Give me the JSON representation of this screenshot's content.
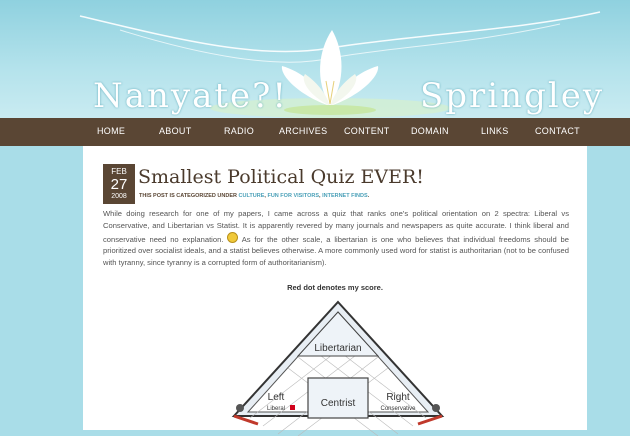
{
  "site": {
    "name_left": "Nanyate?!",
    "name_right": "Springley"
  },
  "nav": {
    "items": [
      "HOME",
      "ABOUT",
      "RADIO",
      "ARCHIVES",
      "CONTENT",
      "DOMAIN",
      "LINKS",
      "CONTACT"
    ]
  },
  "post": {
    "date": {
      "month": "FEB",
      "day": "27",
      "year": "2008"
    },
    "title": "Smallest Political Quiz EVER!",
    "meta_prefix": "THIS POST IS CATEGORIZED UNDER",
    "categories": [
      "CULTURE",
      "FUN FOR VISITORS",
      "INTERNET FINDS"
    ],
    "body_part1": "While doing research for one of my papers, I came across a quiz that ranks one's political orientation on 2 spectra: Liberal vs Conservative, and Libertarian vs Statist. It is apparently revered by many journals and newspapers as quite accurate. I think liberal and conservative need no explanation.",
    "body_part2": "As for the other scale, a libertarian is one who believes that individual freedoms should be prioritized over socialist ideals, and a statist believes otherwise. A more commonly used word for statist is authoritarian (not to be confused with tyranny, since tyranny is a corrupted form of authoritarianism).",
    "caption": "Red dot denotes my score."
  },
  "quiz": {
    "top_label": "Libertarian",
    "left_label": "Left",
    "left_sub": "Liberal",
    "center_label": "Centrist",
    "right_label": "Right",
    "right_sub": "Conservative"
  },
  "colors": {
    "sky": "#a9dde8",
    "nav": "#5a4634",
    "title": "#4a3a2c",
    "link": "#4aa0b8"
  }
}
